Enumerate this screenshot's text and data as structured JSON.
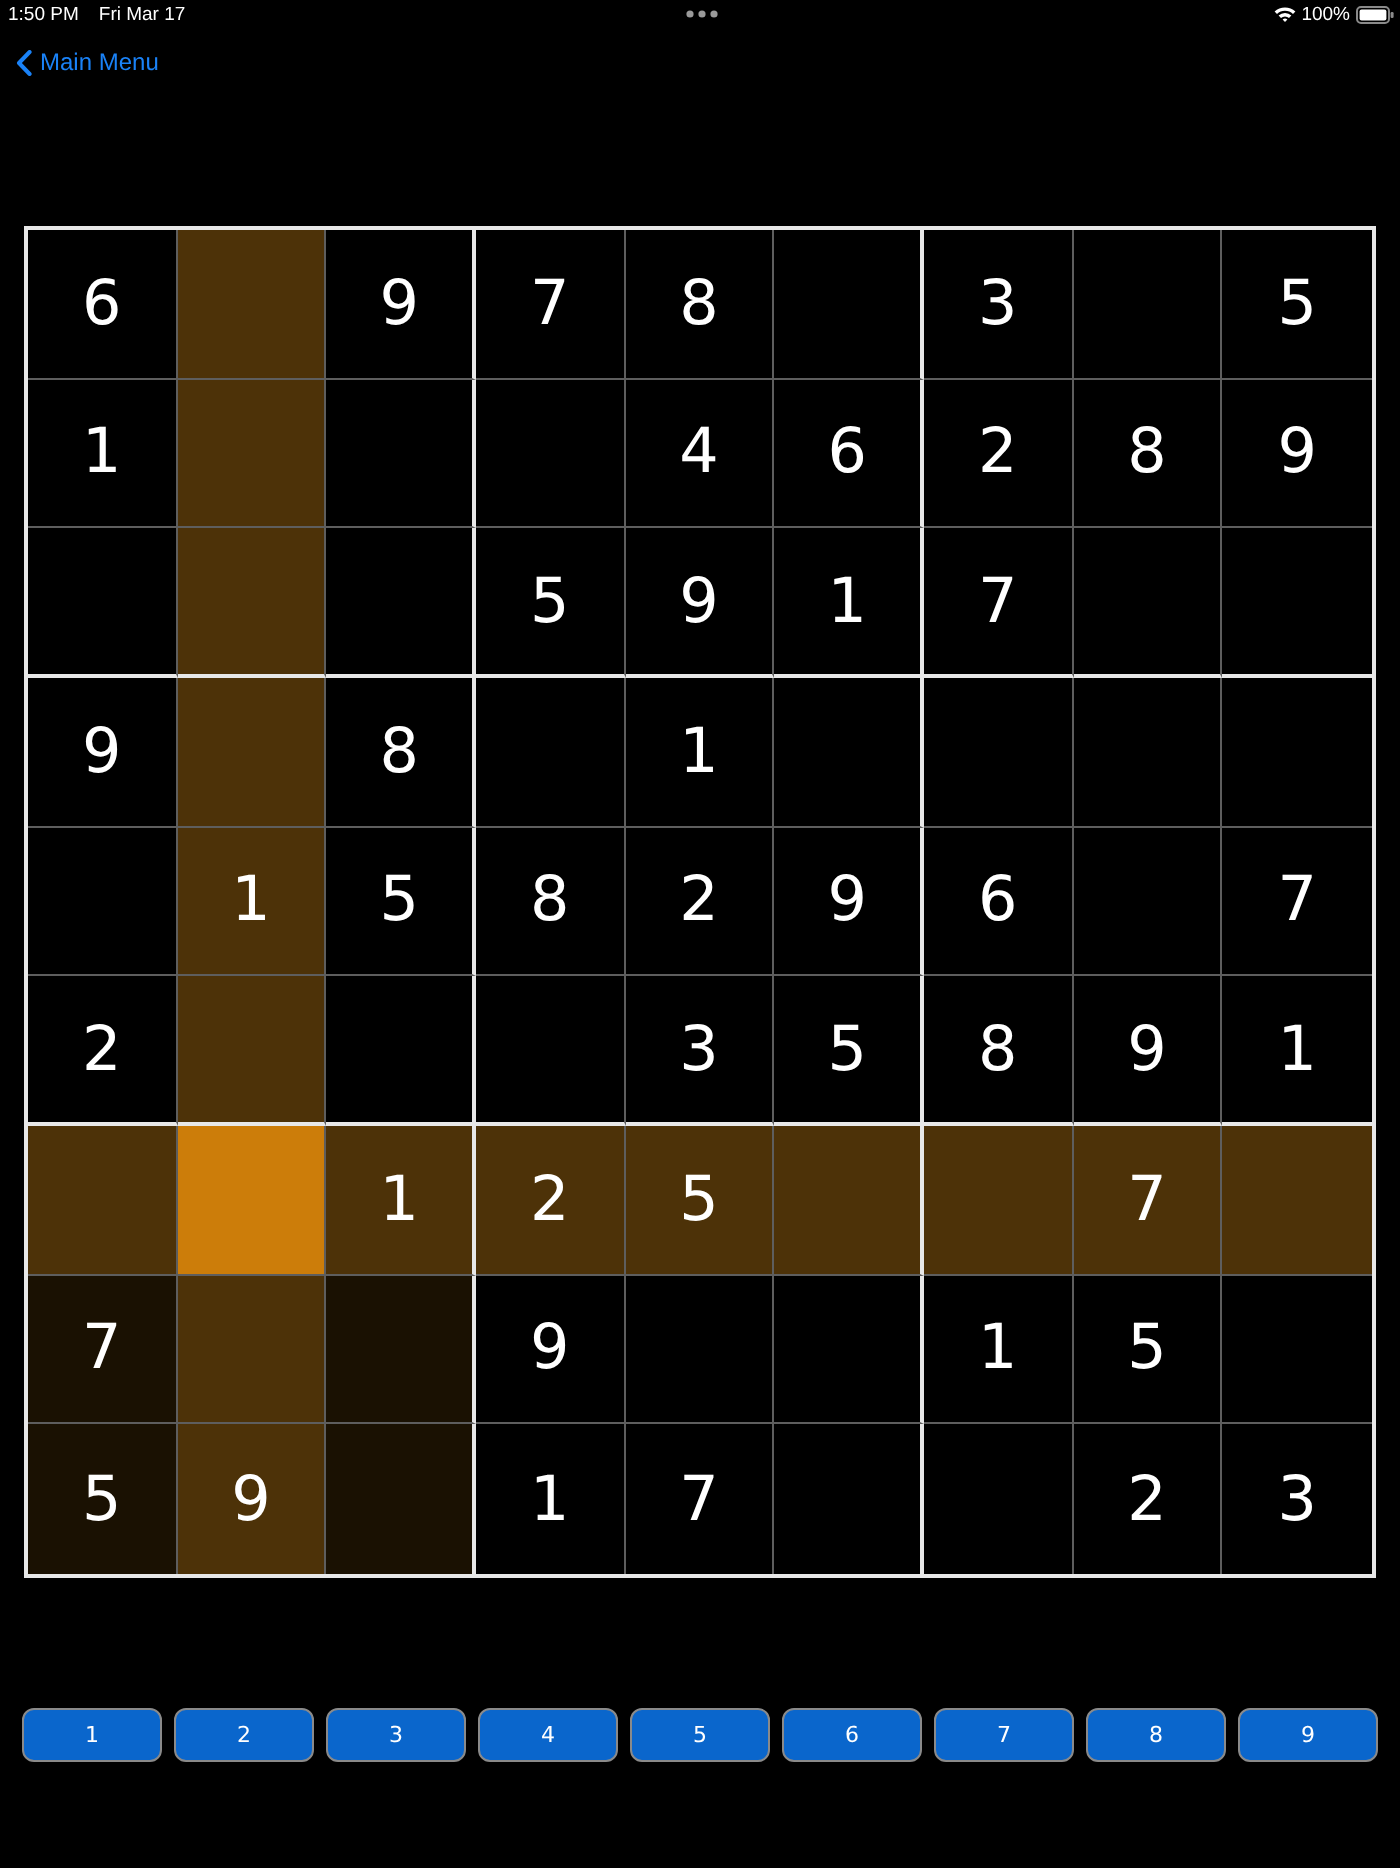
{
  "status_bar": {
    "time": "1:50 PM",
    "date": "Fri Mar 17",
    "battery": "100%"
  },
  "navigation": {
    "back_label": "Main Menu"
  },
  "board": {
    "rows": [
      {
        "cells": [
          {
            "value": "6",
            "selected": false
          },
          {
            "selected": false
          },
          {
            "value": "9",
            "selected": false
          },
          {
            "value": "7",
            "selected": false
          },
          {
            "value": "8",
            "selected": false
          },
          {
            "selected": false
          },
          {
            "value": "3",
            "selected": false
          },
          {
            "selected": false
          },
          {
            "value": "5",
            "selected": false
          }
        ]
      },
      {
        "cells": [
          {
            "value": "1",
            "selected": false
          },
          {
            "selected": false
          },
          {
            "selected": false
          },
          {
            "selected": false
          },
          {
            "value": "4",
            "selected": false
          },
          {
            "value": "6",
            "selected": false
          },
          {
            "value": "2",
            "selected": false
          },
          {
            "value": "8",
            "selected": false
          },
          {
            "value": "9",
            "selected": false
          }
        ]
      },
      {
        "cells": [
          {
            "selected": false
          },
          {
            "selected": false
          },
          {
            "selected": false
          },
          {
            "value": "5",
            "selected": false
          },
          {
            "value": "9",
            "selected": false
          },
          {
            "value": "1",
            "selected": false
          },
          {
            "value": "7",
            "selected": false
          },
          {
            "selected": false
          },
          {
            "selected": false
          }
        ]
      },
      {
        "cells": [
          {
            "value": "9",
            "selected": false
          },
          {
            "selected": false
          },
          {
            "value": "8",
            "selected": false
          },
          {
            "selected": false
          },
          {
            "value": "1",
            "selected": false
          },
          {
            "selected": false
          },
          {
            "selected": false
          },
          {
            "selected": false
          },
          {
            "selected": false
          }
        ]
      },
      {
        "cells": [
          {
            "selected": false
          },
          {
            "value": "1",
            "selected": false
          },
          {
            "value": "5",
            "selected": false
          },
          {
            "value": "8",
            "selected": false
          },
          {
            "value": "2",
            "selected": false
          },
          {
            "value": "9",
            "selected": false
          },
          {
            "value": "6",
            "selected": false
          },
          {
            "selected": false
          },
          {
            "value": "7",
            "selected": false
          }
        ]
      },
      {
        "cells": [
          {
            "value": "2",
            "selected": false
          },
          {
            "selected": false
          },
          {
            "selected": false
          },
          {
            "selected": false
          },
          {
            "value": "3",
            "selected": false
          },
          {
            "value": "5",
            "selected": false
          },
          {
            "value": "8",
            "selected": false
          },
          {
            "value": "9",
            "selected": false
          },
          {
            "value": "1",
            "selected": false
          }
        ]
      },
      {
        "cells": [
          {
            "selected": false
          },
          {
            "selected": true
          },
          {
            "value": "1",
            "selected": false
          },
          {
            "value": "2",
            "selected": false
          },
          {
            "value": "5",
            "selected": false
          },
          {
            "selected": false
          },
          {
            "selected": false
          },
          {
            "value": "7",
            "selected": false
          },
          {
            "selected": false
          }
        ]
      },
      {
        "cells": [
          {
            "value": "7",
            "selected": false
          },
          {
            "selected": false
          },
          {
            "selected": false
          },
          {
            "value": "9",
            "selected": false
          },
          {
            "selected": false
          },
          {
            "selected": false
          },
          {
            "value": "1",
            "selected": false
          },
          {
            "value": "5",
            "selected": false
          },
          {
            "selected": false
          }
        ]
      },
      {
        "cells": [
          {
            "value": "5",
            "selected": false
          },
          {
            "value": "9",
            "selected": false
          },
          {
            "selected": false
          },
          {
            "value": "1",
            "selected": false
          },
          {
            "value": "7",
            "selected": false
          },
          {
            "selected": false
          },
          {
            "selected": false
          },
          {
            "value": "2",
            "selected": false
          },
          {
            "value": "3",
            "selected": false
          }
        ]
      }
    ]
  },
  "keypad": [
    {
      "label": "1"
    },
    {
      "label": "2"
    },
    {
      "label": "3"
    },
    {
      "label": "4"
    },
    {
      "label": "5"
    },
    {
      "label": "6"
    },
    {
      "label": "7"
    },
    {
      "label": "8"
    },
    {
      "label": "9"
    }
  ]
}
